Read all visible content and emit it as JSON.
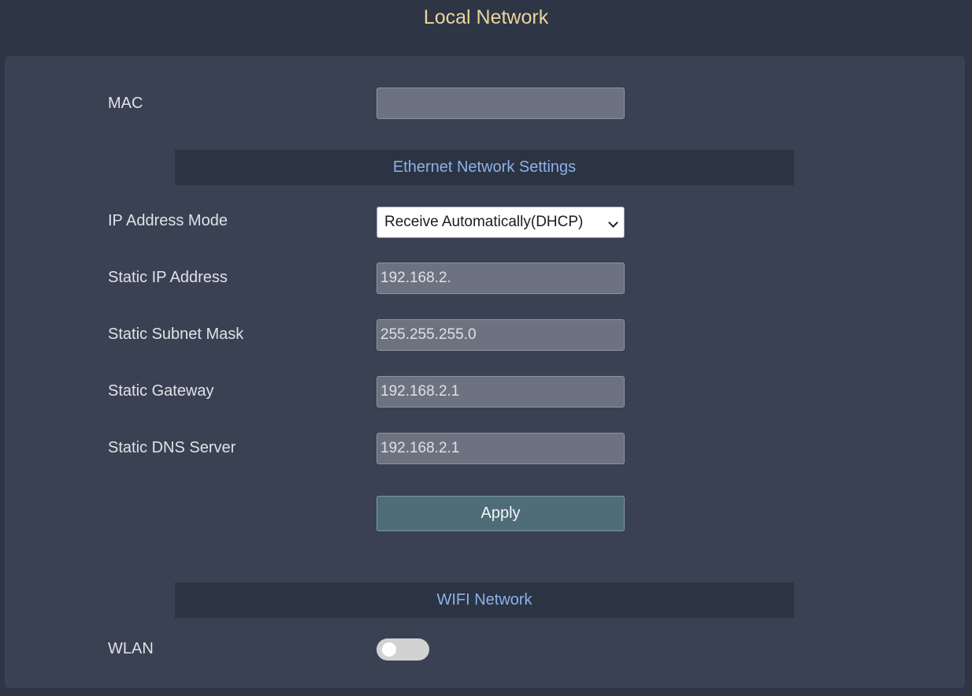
{
  "page": {
    "title": "Local Network"
  },
  "mac": {
    "label": "MAC",
    "value": ""
  },
  "ethernet": {
    "section_title": "Ethernet Network Settings",
    "ip_mode": {
      "label": "IP Address Mode",
      "selected": "Receive Automatically(DHCP)"
    },
    "static_ip": {
      "label": "Static IP Address",
      "value": "192.168.2."
    },
    "subnet_mask": {
      "label": "Static Subnet Mask",
      "value": "255.255.255.0"
    },
    "gateway": {
      "label": "Static Gateway",
      "value": "192.168.2.1"
    },
    "dns": {
      "label": "Static DNS Server",
      "value": "192.168.2.1"
    },
    "apply_label": "Apply"
  },
  "wifi": {
    "section_title": "WIFI Network",
    "wlan": {
      "label": "WLAN",
      "enabled": false
    }
  },
  "colors": {
    "title": "#edd49b",
    "section_header_text": "#8ab2e8",
    "apply_button": "#4f6d79"
  }
}
